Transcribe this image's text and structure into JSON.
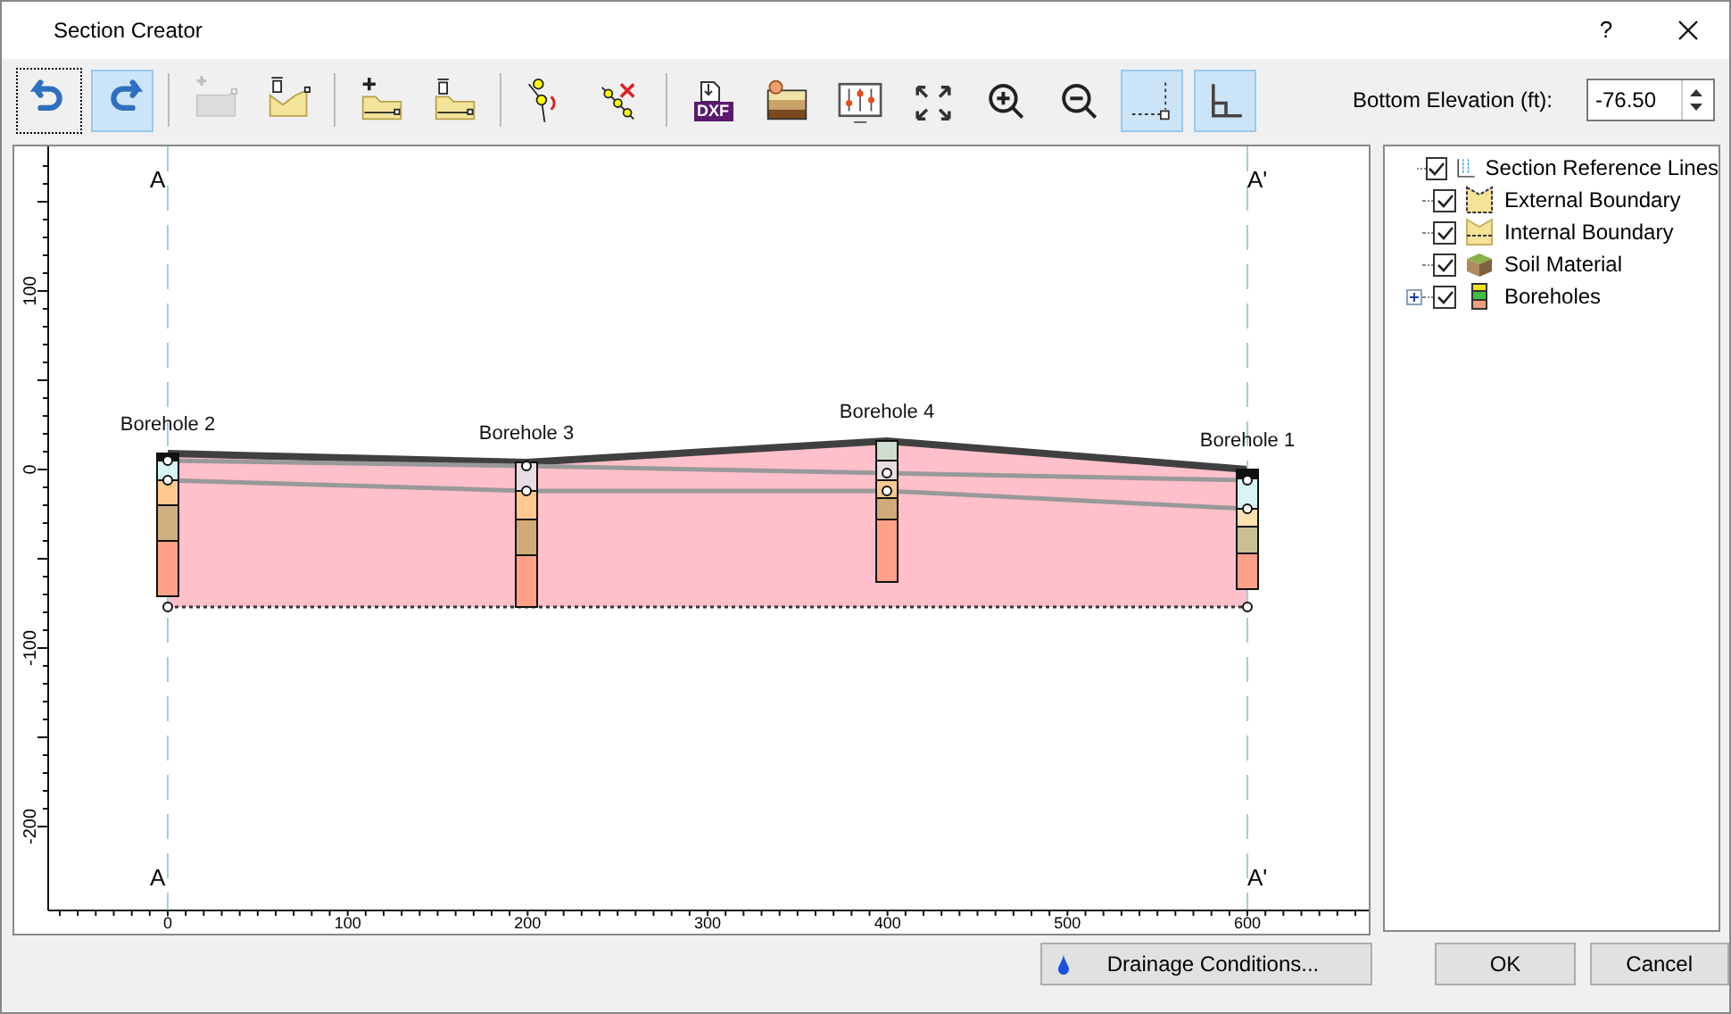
{
  "window": {
    "title": "Section Creator",
    "help": "?"
  },
  "toolbar": [
    {
      "kind": "undo",
      "active": false,
      "focused": true,
      "disabled": false
    },
    {
      "kind": "redo",
      "active": true,
      "focused": false,
      "disabled": false
    },
    {
      "kind": "separator"
    },
    {
      "kind": "add-line",
      "active": false,
      "focused": false,
      "disabled": true
    },
    {
      "kind": "delete-line",
      "active": false,
      "focused": false,
      "disabled": false
    },
    {
      "kind": "separator"
    },
    {
      "kind": "add-boundary",
      "active": false,
      "focused": false,
      "disabled": false
    },
    {
      "kind": "delete-boundary",
      "active": false,
      "focused": false,
      "disabled": false
    },
    {
      "kind": "separator"
    },
    {
      "kind": "move-vertex",
      "active": false,
      "focused": false,
      "disabled": false
    },
    {
      "kind": "delete-vertex",
      "active": false,
      "focused": false,
      "disabled": false
    },
    {
      "kind": "separator"
    },
    {
      "kind": "dxf",
      "label": "DXF",
      "active": false,
      "focused": false,
      "disabled": false
    },
    {
      "kind": "material",
      "active": false,
      "focused": false,
      "disabled": false
    },
    {
      "kind": "display",
      "active": false,
      "focused": false,
      "disabled": false
    },
    {
      "kind": "fit",
      "active": false,
      "focused": false,
      "disabled": false
    },
    {
      "kind": "zoom-in",
      "active": false,
      "focused": false,
      "disabled": false
    },
    {
      "kind": "zoom-out",
      "active": false,
      "focused": false,
      "disabled": false
    },
    {
      "kind": "snap",
      "active": true,
      "focused": false,
      "disabled": false
    },
    {
      "kind": "ortho",
      "active": true,
      "focused": false,
      "disabled": false
    }
  ],
  "bottom_elevation": {
    "label": "Bottom Elevation (ft):",
    "value": "-76.50"
  },
  "section": {
    "top_labels": [
      "A",
      "A'"
    ],
    "bottom_labels": [
      "A",
      "A'"
    ],
    "boreholes": [
      {
        "name": "Borehole 2"
      },
      {
        "name": "Borehole 3"
      },
      {
        "name": "Borehole 4"
      },
      {
        "name": "Borehole 1"
      }
    ],
    "x_ticks": [
      "0",
      "100",
      "200",
      "300",
      "400",
      "500",
      "600"
    ],
    "y_ticks": [
      "100",
      "0",
      "-100",
      "-200"
    ]
  },
  "layers": [
    {
      "kind": "reference",
      "label": "Section Reference Lines",
      "checked": true
    },
    {
      "kind": "external",
      "label": "External Boundary",
      "checked": true
    },
    {
      "kind": "internal",
      "label": "Internal Boundary",
      "checked": true
    },
    {
      "kind": "soil",
      "label": "Soil Material",
      "checked": true
    },
    {
      "kind": "boreholes",
      "label": "Boreholes",
      "checked": true,
      "expanded": false
    }
  ],
  "buttons": {
    "drainage": "Drainage Conditions...",
    "ok": "OK",
    "cancel": "Cancel"
  }
}
